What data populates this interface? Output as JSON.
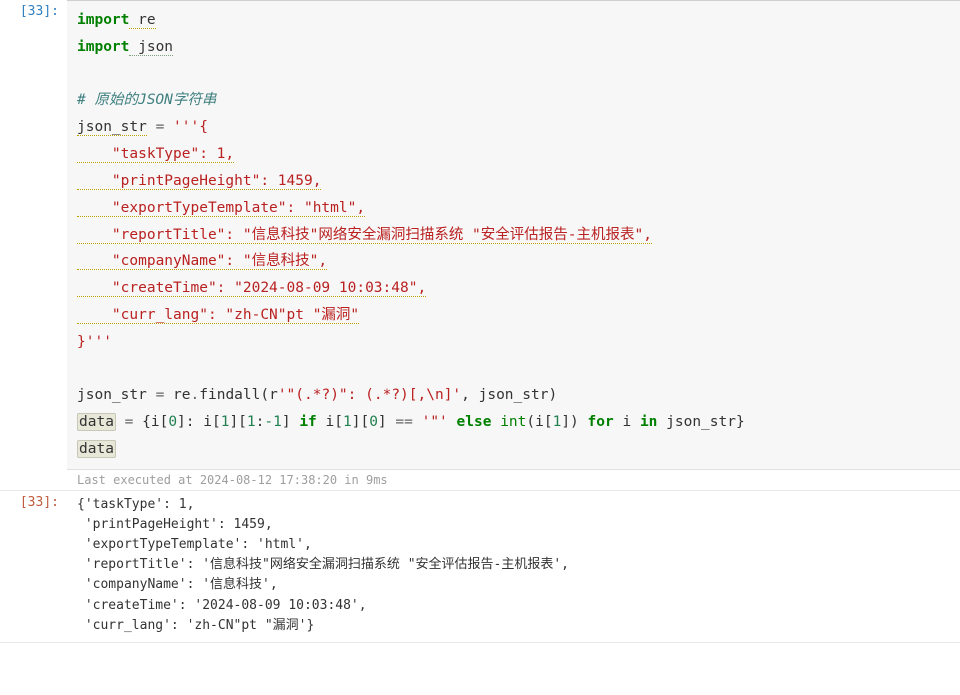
{
  "input_prompt": "[33]:",
  "output_prompt": "[33]:",
  "code_lines": {
    "l01a": "import",
    "l01b": " re",
    "l02a": "import",
    "l02b": " json",
    "l03": "",
    "l04": "# 原始的JSON字符串",
    "l05a": "json_str",
    "l05b": " = ",
    "l05c": "'''{",
    "l06": "    \"taskType\": 1,",
    "l07": "    \"printPageHeight\": 1459,",
    "l08": "    \"exportTypeTemplate\": \"html\",",
    "l09": "    \"reportTitle\": \"信息科技\"网络安全漏洞扫描系统 \"安全评估报告-主机报表\",",
    "l10": "    \"companyName\": \"信息科技\",",
    "l11": "    \"createTime\": \"2024-08-09 10:03:48\",",
    "l12": "    \"curr_lang\": \"zh-CN\"pt \"漏洞\"",
    "l13": "}'''",
    "l14": "",
    "l15a": "json_str ",
    "l15b": "=",
    "l15c": " re",
    "l15d": ".",
    "l15e": "findall",
    "l15f": "(r",
    "l15g": "'\"(.*?)\": (.*?)[,\\n]'",
    "l15h": ", json_str)",
    "l16a": "data",
    "l16b": " ",
    "l16c": "=",
    "l16d": " {i[",
    "l16e": "0",
    "l16f": "]: i[",
    "l16g": "1",
    "l16h": "][",
    "l16i": "1",
    "l16j": ":",
    "l16k": "-1",
    "l16l": "] ",
    "l16m": "if",
    "l16n": " i[",
    "l16o": "1",
    "l16p": "][",
    "l16q": "0",
    "l16r": "] ",
    "l16s": "==",
    "l16t": " ",
    "l16u": "'\"'",
    "l16v": " ",
    "l16w": "else",
    "l16x": " ",
    "l16y": "int",
    "l16z": "(i[",
    "l16aa": "1",
    "l16ab": "]) ",
    "l16ac": "for",
    "l16ad": " i ",
    "l16ae": "in",
    "l16af": " json_str}",
    "l17": "data"
  },
  "exec_info": "Last executed at 2024-08-12 17:38:20 in 9ms",
  "output_lines": {
    "o1": "{'taskType': 1,",
    "o2": " 'printPageHeight': 1459,",
    "o3": " 'exportTypeTemplate': 'html',",
    "o4": " 'reportTitle': '信息科技\"网络安全漏洞扫描系统 \"安全评估报告-主机报表',",
    "o5": " 'companyName': '信息科技',",
    "o6": " 'createTime': '2024-08-09 10:03:48',",
    "o7": " 'curr_lang': 'zh-CN\"pt \"漏洞'}"
  }
}
